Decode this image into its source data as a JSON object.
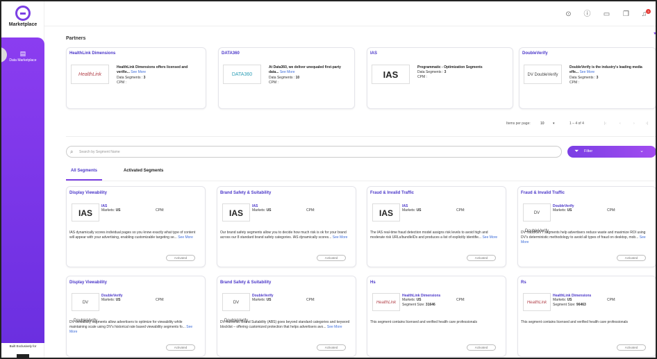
{
  "app": {
    "name": "Marketplace",
    "sidebar_item": "Data Marketplace",
    "built_text": "Built Exclusively for"
  },
  "topbar": {
    "icons": [
      "location-icon",
      "help-icon",
      "card-icon",
      "copy-icon",
      "bell-icon"
    ],
    "bell_count": "3"
  },
  "partners": {
    "title": "Partners",
    "cards": [
      {
        "name": "HealthLink Dimensions",
        "logo": "HealthLink",
        "desc": "HealthLink Dimensions offers licensed and verifie...",
        "see_more": "See More",
        "segments_label": "Data Segments :",
        "segments": "3",
        "cpm_label": "CPM :"
      },
      {
        "name": "DATA360",
        "logo": "DATA360",
        "desc": "At Data360, we deliver unequaled first-party data...",
        "see_more": "See More",
        "segments_label": "Data Segments :",
        "segments": "10",
        "cpm_label": "CPM :"
      },
      {
        "name": "IAS",
        "logo": "IAS",
        "desc": "Programmatic - Optimization Segments",
        "see_more": "",
        "segments_label": "Data Segments :",
        "segments": "3",
        "cpm_label": "CPM :"
      },
      {
        "name": "DoubleVerify",
        "logo": "DV DoubleVerify",
        "desc": "DoubleVerify is the industry's leading media effe...",
        "see_more": "See More",
        "segments_label": "Data Segments :",
        "segments": "3",
        "cpm_label": "CPM :"
      }
    ],
    "pagination": {
      "items_per_page_label": "Items per page:",
      "items_per_page": "10",
      "range": "1 – 4 of 4"
    }
  },
  "search": {
    "placeholder": "Search by Segment Name"
  },
  "filter": {
    "label": "Filter"
  },
  "tabs": {
    "all": "All Segments",
    "activated": "Activated Segments"
  },
  "segments": [
    {
      "title": "Display Viewability",
      "logo": "IAS",
      "logo_type": "ias",
      "provider": "IAS",
      "markets_label": "Markets:",
      "markets": "US",
      "size_label": "",
      "size": "",
      "cpm_label": "CPM:",
      "desc": "IAS dynamically scores individual pages so you know exactly what type of content will appear with your advertising, enabling customizable targeting se...",
      "see_more": "See More",
      "status": "Activated"
    },
    {
      "title": "Brand Safety & Suitability",
      "logo": "IAS",
      "logo_type": "ias",
      "provider": "IAS",
      "markets_label": "Markets:",
      "markets": "US",
      "size_label": "",
      "size": "",
      "cpm_label": "CPM:",
      "desc": "Our brand safety segments allow you to decide how much risk is ok for your brand across our 8 standard brand safety categories. IAS dynamically scores...",
      "see_more": "See More",
      "status": "Activated"
    },
    {
      "title": "Fraud & Invalid Traffic",
      "logo": "IAS",
      "logo_type": "ias",
      "provider": "IAS",
      "markets_label": "Markets:",
      "markets": "US",
      "size_label": "",
      "size": "",
      "cpm_label": "CPM:",
      "desc": "The IAS real-time fraud detection model assigns risk levels to avoid high and moderate risk URLs/bundleIDs and produces a list of explicitly identifie...",
      "see_more": "See More",
      "status": "Activated"
    },
    {
      "title": "Fraud & Invalid Traffic",
      "logo": "DV DoubleVerify",
      "logo_type": "dv",
      "provider": "DoubleVerify",
      "markets_label": "Markets:",
      "markets": "US",
      "size_label": "",
      "size": "",
      "cpm_label": "CPM:",
      "desc": "DV fraud/GIVT segments help advertisers reduce waste and maximize ROI using DV's deterministic methodology to avoid all types of fraud on desktop, mob...",
      "see_more": "See More",
      "status": "Activated"
    },
    {
      "title": "Display Viewability",
      "logo": "DV DoubleVerify",
      "logo_type": "dv",
      "provider": "DoubleVerify",
      "markets_label": "Markets:",
      "markets": "US",
      "size_label": "",
      "size": "",
      "cpm_label": "CPM:",
      "desc": "DV viewability segments allow advertisers to optimize for viewability while maintaining scale using DV's historical rate based viewability segments fo...",
      "see_more": "See More",
      "status": "Activated"
    },
    {
      "title": "Brand Safety & Suitability",
      "logo": "DV DoubleVerify",
      "logo_type": "dv",
      "provider": "DoubleVerify",
      "markets_label": "Markets:",
      "markets": "US",
      "size_label": "",
      "size": "",
      "cpm_label": "CPM:",
      "desc": "DV Authentic Brand Suitability (ABS) goes beyond standard categories and keyword blocklist – offering customized protection that helps advertisers avo...",
      "see_more": "See More",
      "status": "Activated"
    },
    {
      "title": "Hs",
      "logo": "HealthLink",
      "logo_type": "hl",
      "provider": "HealthLink Dimensions",
      "markets_label": "Markets:",
      "markets": "US",
      "size_label": "Segment Size:",
      "size": "31646",
      "cpm_label": "CPM:",
      "desc": "This segment contains licensed and verified health care professionals",
      "see_more": "",
      "status": "Activated"
    },
    {
      "title": "Rs",
      "logo": "HealthLink",
      "logo_type": "hl",
      "provider": "HealthLink Dimensions",
      "markets_label": "Markets:",
      "markets": "US",
      "size_label": "Segment Size:",
      "size": "96463",
      "cpm_label": "CPM:",
      "desc": "This segment contains licensed and verified health care professionals",
      "see_more": "",
      "status": "Activated"
    }
  ]
}
